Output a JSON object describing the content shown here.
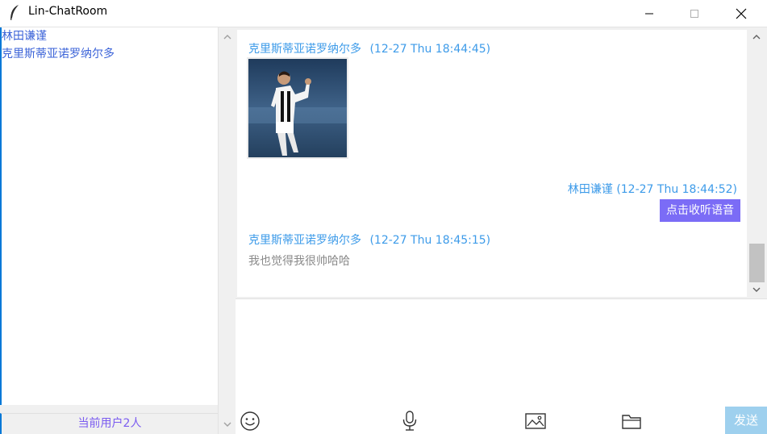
{
  "window": {
    "title": "Lin-ChatRoom",
    "icons": [
      "feather-icon",
      "minimize-icon",
      "maximize-icon",
      "close-icon"
    ]
  },
  "users": {
    "items": [
      "林田谦谨",
      "克里斯蒂亚诺罗纳尔多"
    ],
    "count_label": "当前用户2人"
  },
  "messages": [
    {
      "sender": "克里斯蒂亚诺罗纳尔多",
      "time": "(12-27 Thu 18:44:45)",
      "type": "image"
    },
    {
      "sender": "林田谦谨",
      "time": "(12-27 Thu 18:44:52)",
      "type": "voice",
      "voice_label": "点击收听语音"
    },
    {
      "sender": "克里斯蒂亚诺罗纳尔多",
      "time": "(12-27 Thu 18:45:15)",
      "type": "text",
      "text": "我也觉得我很帅哈哈"
    }
  ],
  "toolbar": {
    "send_label": "发送",
    "icons": [
      "emoji-icon",
      "microphone-icon",
      "image-icon",
      "folder-icon"
    ]
  },
  "colors": {
    "accent_user": "#3b63d8",
    "message_header": "#3d9be9",
    "voice_button": "#7b6cf6",
    "send_button": "#9ed0ee",
    "user_count": "#7b5cf0"
  }
}
